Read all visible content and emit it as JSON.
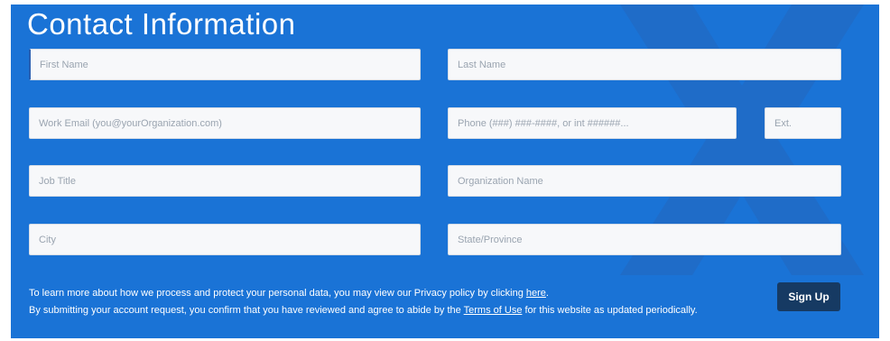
{
  "form": {
    "title": "Contact Information",
    "fields": {
      "first_name": {
        "placeholder": "First Name",
        "value": ""
      },
      "last_name": {
        "placeholder": "Last Name",
        "value": ""
      },
      "work_email": {
        "placeholder": "Work Email (you@yourOrganization.com)",
        "value": ""
      },
      "phone": {
        "placeholder": "Phone (###) ###-####, or int ######...",
        "value": ""
      },
      "ext": {
        "placeholder": "Ext.",
        "value": ""
      },
      "job_title": {
        "placeholder": "Job Title",
        "value": ""
      },
      "organization": {
        "placeholder": "Organization Name",
        "value": ""
      },
      "city": {
        "placeholder": "City",
        "value": ""
      },
      "state": {
        "placeholder": "State/Province",
        "value": ""
      }
    },
    "privacy": {
      "text": "To learn more about how we process and protect your personal data, you may view our Privacy policy by clicking ",
      "link": "here",
      "end": "."
    },
    "terms": {
      "text": "By submitting your account request, you confirm that you have reviewed and agree to abide by the ",
      "link": "Terms of Use",
      "end": " for this website as updated periodically."
    },
    "submit_label": "Sign Up"
  },
  "colors": {
    "panel_bg": "#1a73d6",
    "button_bg": "#163a63",
    "field_bg": "#f7f8fa"
  }
}
